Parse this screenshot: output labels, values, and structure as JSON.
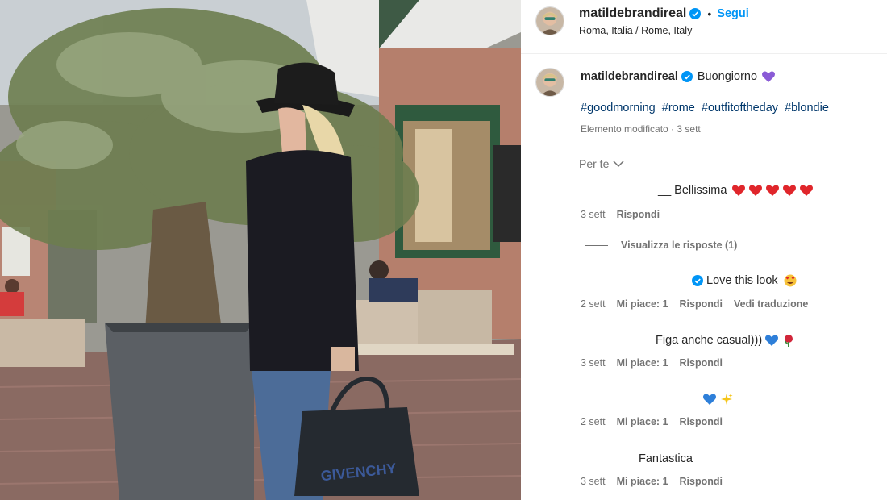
{
  "post": {
    "username": "matildebrandireal",
    "follow_label": "Segui",
    "separator": "•",
    "location": "Roma, Italia / Rome, Italy"
  },
  "caption": {
    "username": "matildebrandireal",
    "text": "Buongiorno",
    "hashtags": [
      "#goodmorning",
      "#rome",
      "#outfitoftheday",
      "#blondie"
    ],
    "edited": "Elemento modificato · 3 sett"
  },
  "filter_label": "Per te",
  "comments": [
    {
      "text": "__ Bellissima",
      "emoji": [
        "red-heart",
        "red-heart",
        "red-heart",
        "red-heart",
        "red-heart"
      ],
      "time": "3 sett",
      "actions": [
        "Rispondi"
      ]
    },
    {
      "text": "Love this look",
      "emoji": [
        "heart-eyes-face"
      ],
      "verified": true,
      "time": "2 sett",
      "actions": [
        "Mi piace: 1",
        "Rispondi",
        "Vedi traduzione"
      ]
    },
    {
      "text": "Figa anche casual)))",
      "emoji": [
        "blue-heart",
        "rose"
      ],
      "time": "3 sett",
      "actions": [
        "Mi piace: 1",
        "Rispondi"
      ]
    },
    {
      "text": "",
      "emoji": [
        "blue-heart",
        "sparkles"
      ],
      "time": "2 sett",
      "actions": [
        "Mi piace: 1",
        "Rispondi"
      ]
    },
    {
      "text": "Fantastica",
      "emoji": [],
      "time": "3 sett",
      "actions": [
        "Mi piace: 1",
        "Rispondi"
      ]
    }
  ],
  "view_replies": "Visualizza le risposte (1)",
  "colors": {
    "link": "#0095f6",
    "hashtag": "#00376b",
    "meta": "#737373",
    "text": "#262626"
  }
}
